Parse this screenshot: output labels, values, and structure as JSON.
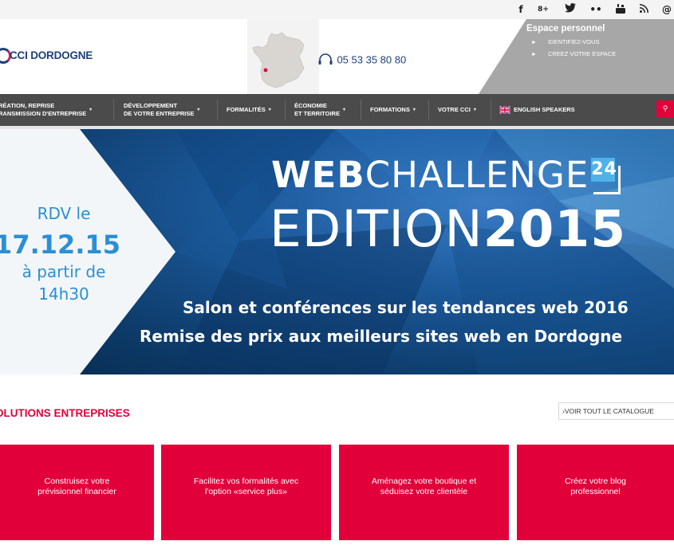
{
  "social": {
    "icons": [
      "facebook-icon",
      "google-plus-icon",
      "twitter-icon",
      "flickr-icon",
      "youtube-icon",
      "rss-icon",
      "email-icon"
    ],
    "glyphs": [
      "f",
      "8+",
      "✦",
      "••",
      "▣",
      "ʐ",
      "@"
    ]
  },
  "header": {
    "logo_text": "CCI DORDOGNE",
    "phone": "05 53 35 80 80",
    "espace": {
      "title": "Espace personnel",
      "links": [
        "IDENTIFIEZ-VOUS",
        "CREEZ VOTRE ESPACE"
      ]
    }
  },
  "nav": {
    "items": [
      {
        "line1": "RÉATION, REPRISE",
        "line2": "RANSMISSION D'ENTREPRISE"
      },
      {
        "line1": "DÉVELOPPEMENT",
        "line2": "DE VOTRE ENTREPRISE"
      },
      {
        "line1": "FORMALITÉS",
        "line2": ""
      },
      {
        "line1": "ÉCONOMIE",
        "line2": "ET TERRITOIRE"
      },
      {
        "line1": "FORMATIONS",
        "line2": ""
      },
      {
        "line1": "VOTRE CCI",
        "line2": ""
      },
      {
        "line1": "ENGLISH SPEAKERS",
        "line2": ""
      }
    ],
    "caret": "▾",
    "search_glyph": "⚲"
  },
  "banner": {
    "rdv_label": "RDV le",
    "date": "17.12.15",
    "from_label": "à partir de",
    "time": "14h30",
    "web": "WEB",
    "challenge": "CHALLENGE",
    "badge": "24",
    "edition": "EDITION",
    "year": "2015",
    "line1": "Salon et conférences sur les tendances web 2016",
    "line2": "Remise des prix aux meilleurs sites web en Dordogne",
    "colors": {
      "accent": "#4fb3e8",
      "date_blue": "#2a8fd6"
    }
  },
  "solutions": {
    "title": "OLUTIONS ENTREPRISES",
    "catalogue_link": "VOIR TOUT LE CATALOGUE",
    "catalogue_arrow": "›",
    "cards": [
      {
        "line1": "Construisez votre",
        "line2": "prévisionnel financier"
      },
      {
        "line1": "Facilitez vos formalités avec",
        "line2": "l'option «service plus»"
      },
      {
        "line1": "Aménagez votre boutique et",
        "line2": "séduisez votre clientèle"
      },
      {
        "line1": "Créez votre blog",
        "line2": "professionnel"
      }
    ],
    "color": "#e2003b"
  }
}
